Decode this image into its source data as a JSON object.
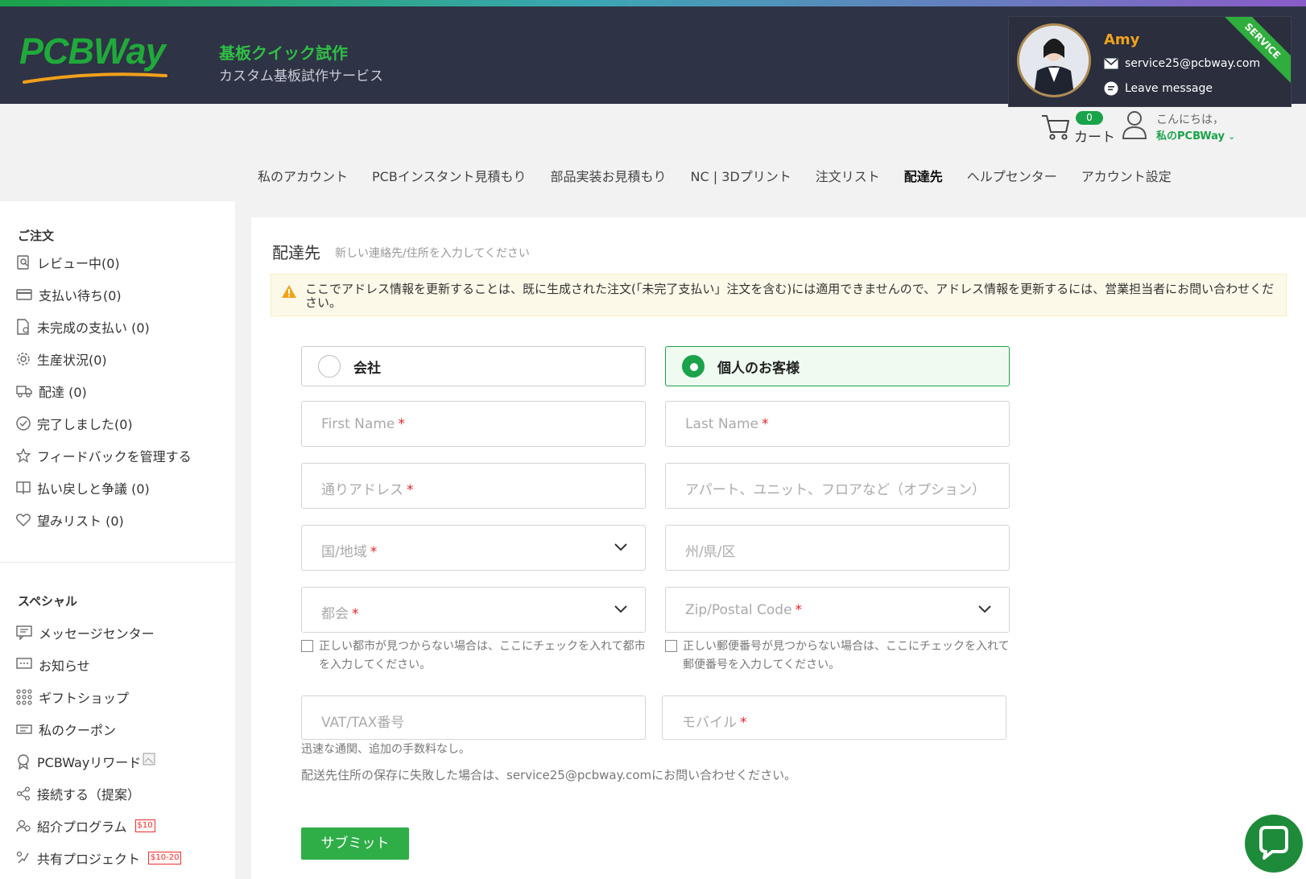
{
  "header": {
    "logo_text": "PCBWay",
    "brand_title": "基板クイック試作",
    "brand_subtitle": "カスタム基板試作サービス"
  },
  "service_card": {
    "ribbon": "SERVICE",
    "agent_name": "Amy",
    "email": "service25@pcbway.com",
    "leave_message": "Leave message"
  },
  "cart": {
    "count": "0",
    "label": "カート"
  },
  "user": {
    "greeting": "こんにちは，",
    "account": "私のPCBWay"
  },
  "nav": {
    "items": [
      {
        "label": "私のアカウント"
      },
      {
        "label": "PCBインスタント見積もり"
      },
      {
        "label": "部品実装お見積もり"
      },
      {
        "label": "NC | 3Dプリント"
      },
      {
        "label": "注文リスト"
      },
      {
        "label": "配達先"
      },
      {
        "label": "ヘルプセンター"
      },
      {
        "label": "アカウント設定"
      }
    ],
    "active": "配達先"
  },
  "sidebar": {
    "orders_heading": "ご注文",
    "orders": [
      {
        "label": "レビュー中(0)",
        "icon": "review-icon"
      },
      {
        "label": "支払い待ち(0)",
        "icon": "card-icon"
      },
      {
        "label": "未完成の支払い (0)",
        "icon": "document-icon"
      },
      {
        "label": "生産状況(0)",
        "icon": "gear-icon"
      },
      {
        "label": "配達 (0)",
        "icon": "truck-icon"
      },
      {
        "label": "完了しました(0)",
        "icon": "check-circle-icon"
      },
      {
        "label": "フィードバックを管理する",
        "icon": "star-icon"
      },
      {
        "label": "払い戻しと争議 (0)",
        "icon": "refund-icon"
      },
      {
        "label": "望みリスト (0)",
        "icon": "heart-icon"
      }
    ],
    "special_heading": "スペシャル",
    "special": [
      {
        "label": "メッセージセンター",
        "icon": "message-icon"
      },
      {
        "label": "お知らせ",
        "icon": "notice-icon"
      },
      {
        "label": "ギフトショップ",
        "icon": "grid-icon"
      },
      {
        "label": "私のクーポン",
        "icon": "coupon-icon"
      },
      {
        "label": "PCBWayリワード",
        "icon": "award-icon"
      },
      {
        "label": "接続する（提案）",
        "icon": "share-icon"
      },
      {
        "label": "紹介プログラム",
        "icon": "referral-icon",
        "tag": "$10"
      },
      {
        "label": "共有プロジェクト",
        "icon": "share-project-icon",
        "tag": "$10-20"
      }
    ]
  },
  "main": {
    "title": "配達先",
    "subtitle": "新しい連絡先/住所を入力してください",
    "notice": "ここでアドレス情報を更新することは、既に生成された注文(「未完了支払い」注文を含む)には適用できませんので、アドレス情報を更新するには、営業担当者にお問い合わせください。",
    "type_options": [
      {
        "label": "会社",
        "selected": false
      },
      {
        "label": "個人のお客様",
        "selected": true
      }
    ],
    "fields": {
      "first_name": "First Name",
      "last_name": "Last Name",
      "street": "通りアドレス",
      "apartment": "アパート、ユニット、フロアなど（オプション）",
      "country": "国/地域",
      "state": "州/県/区",
      "city": "都会",
      "zip": "Zip/Postal Code",
      "vat": "VAT/TAX番号",
      "mobile": "モバイル"
    },
    "required_mark": "*",
    "city_check": "正しい都市が見つからない場合は、ここにチェックを入れて都市を入力してください。",
    "zip_check": "正しい郵便番号が見つからない場合は、ここにチェックを入れて郵便番号を入力してください。",
    "vat_hint": "迅速な通関、追加の手数料なし。",
    "save_fail_hint": "配送先住所の保存に失敗した場合は、service25@pcbway.comにお問い合わせください。",
    "submit_label": "サブミット"
  },
  "colors": {
    "brand_green": "#1aa34a",
    "header_bg": "#2e3345",
    "agent_name": "#f0a31a",
    "required": "#e0262a"
  }
}
